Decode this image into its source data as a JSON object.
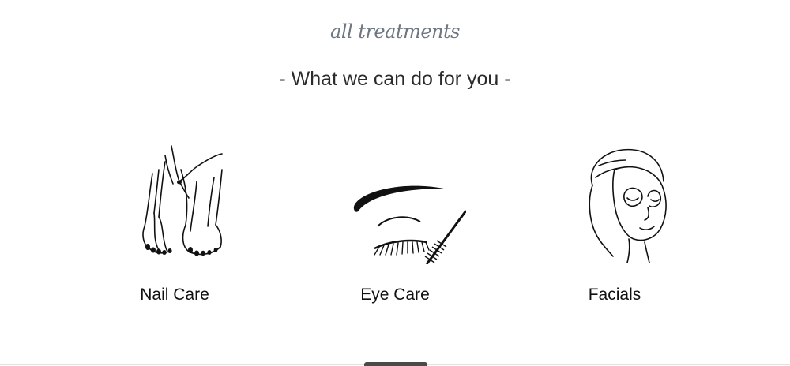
{
  "section": {
    "eyebrow": "all treatments",
    "headline": "- What we can do for you -"
  },
  "treatments": [
    {
      "label": "Nail Care",
      "icon": "nail-care-illustration-icon"
    },
    {
      "label": "Eye Care",
      "icon": "eye-care-illustration-icon"
    },
    {
      "label": "Facials",
      "icon": "facial-mask-illustration-icon"
    }
  ],
  "colors": {
    "eyebrow": "#6e7780",
    "headline": "#2b2b2b",
    "label": "#111111",
    "line_art": "#111111"
  }
}
